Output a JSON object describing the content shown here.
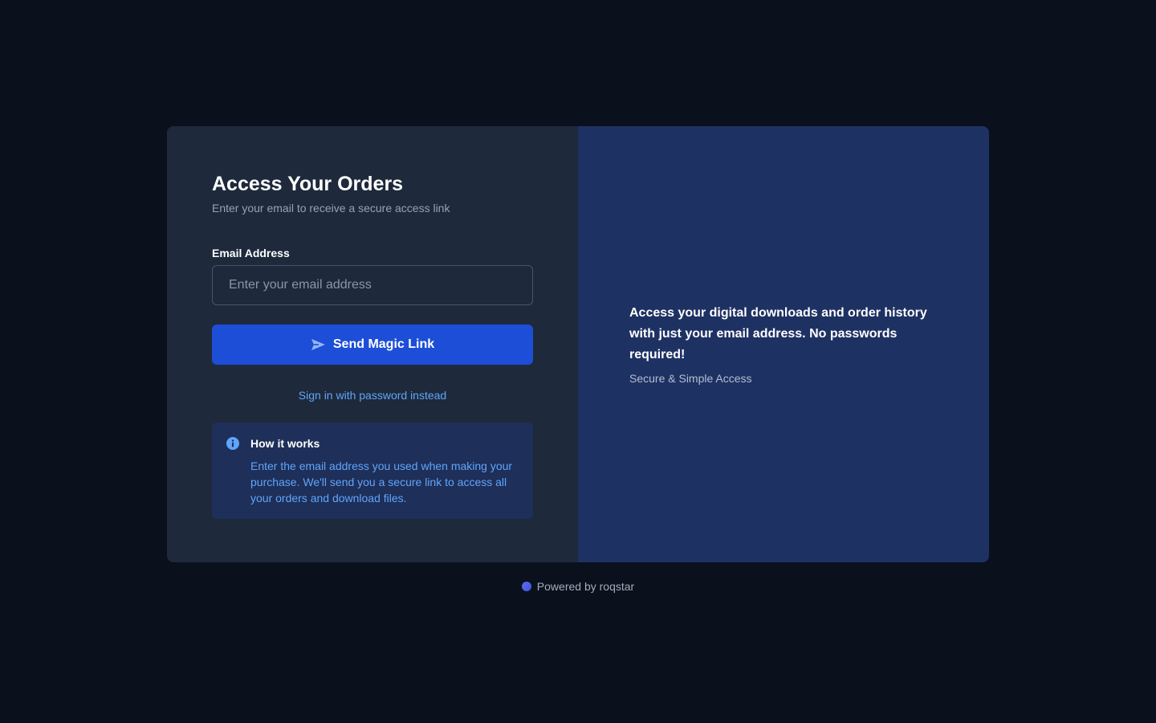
{
  "login": {
    "title": "Access Your Orders",
    "subtitle": "Enter your email to receive a secure access link",
    "email_label": "Email Address",
    "email_placeholder": "Enter your email address",
    "email_value": "",
    "submit_label": "Send Magic Link",
    "submit_icon": "send-icon",
    "alt_link": "Sign in with password instead",
    "info": {
      "icon": "info-icon",
      "title": "How it works",
      "text": "Enter the email address you used when making your purchase. We'll send you a secure link to access all your orders and download files."
    }
  },
  "promo": {
    "text": "Access your digital downloads and order history with just your email address. No passwords required!",
    "tagline": "Secure & Simple Access"
  },
  "footer": {
    "text": "Powered by roqstar"
  },
  "colors": {
    "background": "#0a101c",
    "panel": "#1e293b",
    "promo_panel": "#1e3163",
    "accent": "#1d4ed8",
    "link": "#60a5fa"
  }
}
